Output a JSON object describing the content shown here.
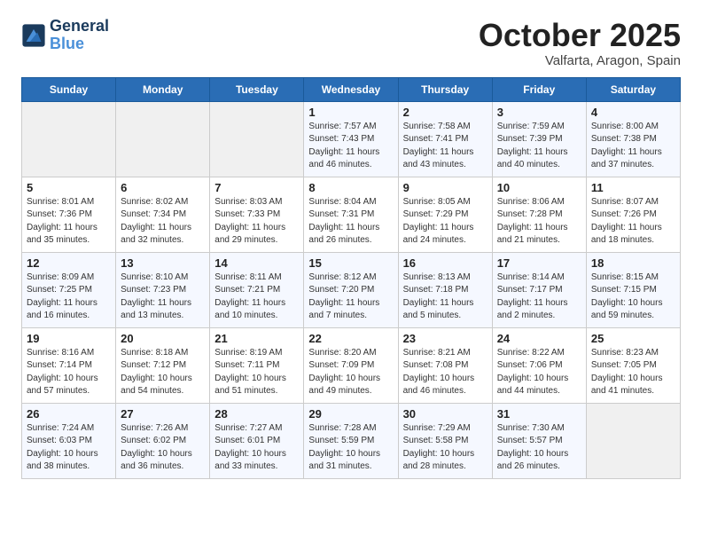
{
  "header": {
    "logo_line1": "General",
    "logo_line2": "Blue",
    "month": "October 2025",
    "location": "Valfarta, Aragon, Spain"
  },
  "days_of_week": [
    "Sunday",
    "Monday",
    "Tuesday",
    "Wednesday",
    "Thursday",
    "Friday",
    "Saturday"
  ],
  "weeks": [
    [
      {
        "day": "",
        "info": ""
      },
      {
        "day": "",
        "info": ""
      },
      {
        "day": "",
        "info": ""
      },
      {
        "day": "1",
        "info": "Sunrise: 7:57 AM\nSunset: 7:43 PM\nDaylight: 11 hours\nand 46 minutes."
      },
      {
        "day": "2",
        "info": "Sunrise: 7:58 AM\nSunset: 7:41 PM\nDaylight: 11 hours\nand 43 minutes."
      },
      {
        "day": "3",
        "info": "Sunrise: 7:59 AM\nSunset: 7:39 PM\nDaylight: 11 hours\nand 40 minutes."
      },
      {
        "day": "4",
        "info": "Sunrise: 8:00 AM\nSunset: 7:38 PM\nDaylight: 11 hours\nand 37 minutes."
      }
    ],
    [
      {
        "day": "5",
        "info": "Sunrise: 8:01 AM\nSunset: 7:36 PM\nDaylight: 11 hours\nand 35 minutes."
      },
      {
        "day": "6",
        "info": "Sunrise: 8:02 AM\nSunset: 7:34 PM\nDaylight: 11 hours\nand 32 minutes."
      },
      {
        "day": "7",
        "info": "Sunrise: 8:03 AM\nSunset: 7:33 PM\nDaylight: 11 hours\nand 29 minutes."
      },
      {
        "day": "8",
        "info": "Sunrise: 8:04 AM\nSunset: 7:31 PM\nDaylight: 11 hours\nand 26 minutes."
      },
      {
        "day": "9",
        "info": "Sunrise: 8:05 AM\nSunset: 7:29 PM\nDaylight: 11 hours\nand 24 minutes."
      },
      {
        "day": "10",
        "info": "Sunrise: 8:06 AM\nSunset: 7:28 PM\nDaylight: 11 hours\nand 21 minutes."
      },
      {
        "day": "11",
        "info": "Sunrise: 8:07 AM\nSunset: 7:26 PM\nDaylight: 11 hours\nand 18 minutes."
      }
    ],
    [
      {
        "day": "12",
        "info": "Sunrise: 8:09 AM\nSunset: 7:25 PM\nDaylight: 11 hours\nand 16 minutes."
      },
      {
        "day": "13",
        "info": "Sunrise: 8:10 AM\nSunset: 7:23 PM\nDaylight: 11 hours\nand 13 minutes."
      },
      {
        "day": "14",
        "info": "Sunrise: 8:11 AM\nSunset: 7:21 PM\nDaylight: 11 hours\nand 10 minutes."
      },
      {
        "day": "15",
        "info": "Sunrise: 8:12 AM\nSunset: 7:20 PM\nDaylight: 11 hours\nand 7 minutes."
      },
      {
        "day": "16",
        "info": "Sunrise: 8:13 AM\nSunset: 7:18 PM\nDaylight: 11 hours\nand 5 minutes."
      },
      {
        "day": "17",
        "info": "Sunrise: 8:14 AM\nSunset: 7:17 PM\nDaylight: 11 hours\nand 2 minutes."
      },
      {
        "day": "18",
        "info": "Sunrise: 8:15 AM\nSunset: 7:15 PM\nDaylight: 10 hours\nand 59 minutes."
      }
    ],
    [
      {
        "day": "19",
        "info": "Sunrise: 8:16 AM\nSunset: 7:14 PM\nDaylight: 10 hours\nand 57 minutes."
      },
      {
        "day": "20",
        "info": "Sunrise: 8:18 AM\nSunset: 7:12 PM\nDaylight: 10 hours\nand 54 minutes."
      },
      {
        "day": "21",
        "info": "Sunrise: 8:19 AM\nSunset: 7:11 PM\nDaylight: 10 hours\nand 51 minutes."
      },
      {
        "day": "22",
        "info": "Sunrise: 8:20 AM\nSunset: 7:09 PM\nDaylight: 10 hours\nand 49 minutes."
      },
      {
        "day": "23",
        "info": "Sunrise: 8:21 AM\nSunset: 7:08 PM\nDaylight: 10 hours\nand 46 minutes."
      },
      {
        "day": "24",
        "info": "Sunrise: 8:22 AM\nSunset: 7:06 PM\nDaylight: 10 hours\nand 44 minutes."
      },
      {
        "day": "25",
        "info": "Sunrise: 8:23 AM\nSunset: 7:05 PM\nDaylight: 10 hours\nand 41 minutes."
      }
    ],
    [
      {
        "day": "26",
        "info": "Sunrise: 7:24 AM\nSunset: 6:03 PM\nDaylight: 10 hours\nand 38 minutes."
      },
      {
        "day": "27",
        "info": "Sunrise: 7:26 AM\nSunset: 6:02 PM\nDaylight: 10 hours\nand 36 minutes."
      },
      {
        "day": "28",
        "info": "Sunrise: 7:27 AM\nSunset: 6:01 PM\nDaylight: 10 hours\nand 33 minutes."
      },
      {
        "day": "29",
        "info": "Sunrise: 7:28 AM\nSunset: 5:59 PM\nDaylight: 10 hours\nand 31 minutes."
      },
      {
        "day": "30",
        "info": "Sunrise: 7:29 AM\nSunset: 5:58 PM\nDaylight: 10 hours\nand 28 minutes."
      },
      {
        "day": "31",
        "info": "Sunrise: 7:30 AM\nSunset: 5:57 PM\nDaylight: 10 hours\nand 26 minutes."
      },
      {
        "day": "",
        "info": ""
      }
    ]
  ]
}
